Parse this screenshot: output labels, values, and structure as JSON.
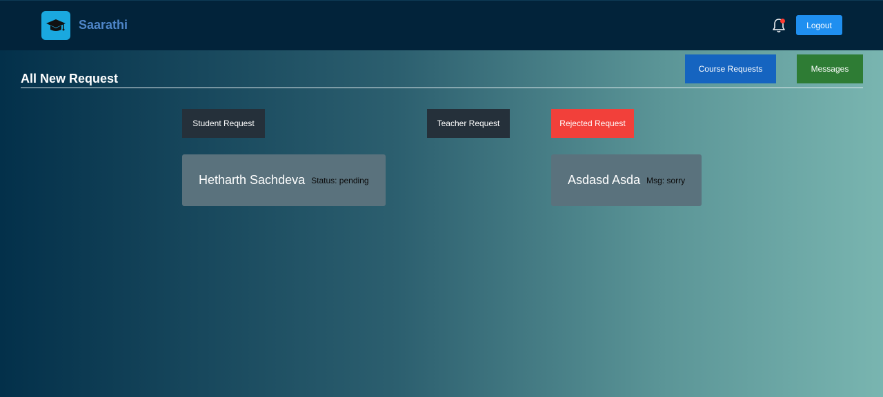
{
  "header": {
    "brand": "Saarathi",
    "logout_label": "Logout"
  },
  "top_actions": {
    "course_requests_label": "Course Requests",
    "messages_label": "Messages"
  },
  "page": {
    "title": "All New Request"
  },
  "tabs": [
    {
      "label": "Student Request"
    },
    {
      "label": "Teacher Request"
    },
    {
      "label": "Rejected Request"
    }
  ],
  "cards": [
    {
      "name": "Hetharth Sachdeva",
      "meta": "Status: pending"
    },
    {
      "name": "Asdasd Asda",
      "meta": "Msg: sorry"
    }
  ],
  "icons": {
    "logo": "graduation-cap-icon",
    "notification": "bell-icon"
  },
  "colors": {
    "logout_button": "#1f8ff0",
    "course_requests_button": "#1564c0",
    "messages_button": "#2e7c34",
    "rejected_tab": "#f2403a",
    "dark_tab": "#25303a",
    "brand_text": "#4f86c9"
  }
}
